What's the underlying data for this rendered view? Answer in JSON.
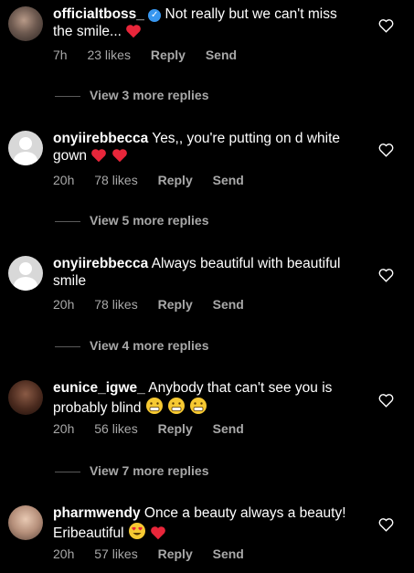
{
  "comments": [
    {
      "username": "officialtboss_",
      "verified": true,
      "text": " Not really but we can't miss the smile...",
      "emojis": [
        "red-heart"
      ],
      "time": "7h",
      "likes": "23 likes",
      "reply_label": "Reply",
      "send_label": "Send",
      "view_replies": "View 3 more replies"
    },
    {
      "username": "onyiirebbecca",
      "verified": false,
      "text": " Yes,, you're putting on d white gown",
      "emojis": [
        "red-heart",
        "red-heart"
      ],
      "time": "20h",
      "likes": "78 likes",
      "reply_label": "Reply",
      "send_label": "Send",
      "view_replies": "View 5 more replies"
    },
    {
      "username": "onyiirebbecca",
      "verified": false,
      "text": " Always beautiful with beautiful smile",
      "emojis": [],
      "time": "20h",
      "likes": "78 likes",
      "reply_label": "Reply",
      "send_label": "Send",
      "view_replies": "View 4 more replies"
    },
    {
      "username": "eunice_igwe_",
      "verified": false,
      "text": " Anybody that can't see you is probably blind",
      "emojis": [
        "grimacing-face",
        "grimacing-face",
        "grimacing-face"
      ],
      "time": "20h",
      "likes": "56 likes",
      "reply_label": "Reply",
      "send_label": "Send",
      "view_replies": "View 7 more replies"
    },
    {
      "username": "pharmwendy",
      "verified": false,
      "text": " Once a beauty always a beauty! Eribeautiful",
      "emojis": [
        "heart-eyes-face",
        "red-heart"
      ],
      "time": "20h",
      "likes": "57 likes",
      "reply_label": "Reply",
      "send_label": "Send",
      "view_replies": ""
    }
  ],
  "colors": {
    "background": "#000000",
    "text": "#ffffff",
    "muted": "#a8a8a8",
    "verified": "#3897f0",
    "heart": "#e8263a"
  }
}
